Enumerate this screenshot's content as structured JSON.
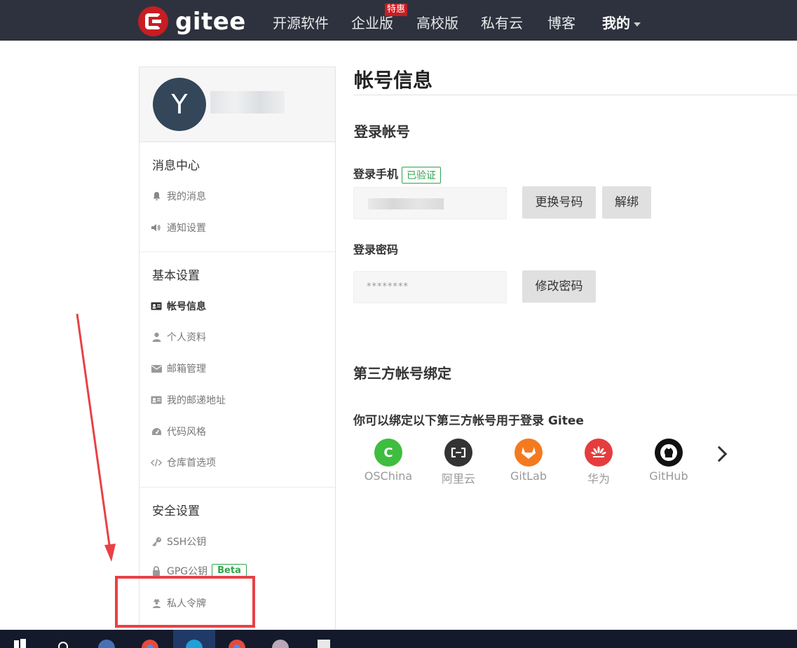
{
  "nav": {
    "brand": "gitee",
    "items": [
      "开源软件",
      "企业版",
      "高校版",
      "私有云",
      "博客"
    ],
    "promo_badge": "特惠",
    "mine": "我的"
  },
  "sidebar": {
    "avatar_letter": "Y",
    "sections": [
      {
        "title": "消息中心",
        "items": [
          {
            "label": "我的消息",
            "icon": "bell-icon"
          },
          {
            "label": "通知设置",
            "icon": "speaker-icon"
          }
        ]
      },
      {
        "title": "基本设置",
        "items": [
          {
            "label": "帐号信息",
            "icon": "id-card-icon",
            "active": true
          },
          {
            "label": "个人资料",
            "icon": "user-icon"
          },
          {
            "label": "邮箱管理",
            "icon": "envelope-icon"
          },
          {
            "label": "我的邮递地址",
            "icon": "address-card-icon"
          },
          {
            "label": "代码风格",
            "icon": "dashboard-icon"
          },
          {
            "label": "仓库首选项",
            "icon": "code-icon"
          }
        ]
      },
      {
        "title": "安全设置",
        "items": [
          {
            "label": "SSH公钥",
            "icon": "key-icon"
          },
          {
            "label": "GPG公钥",
            "icon": "lock-icon",
            "badge": "Beta"
          },
          {
            "label": "私人令牌",
            "icon": "user-secret-icon"
          }
        ]
      }
    ]
  },
  "main": {
    "title": "帐号信息",
    "login_section_title": "登录帐号",
    "phone_label": "登录手机",
    "phone_verified_badge": "已验证",
    "change_number_button": "更换号码",
    "unbind_button": "解绑",
    "password_label": "登录密码",
    "password_masked": "********",
    "change_password_button": "修改密码",
    "third_party_title": "第三方帐号绑定",
    "third_party_hint": "你可以绑定以下第三方帐号用于登录 Gitee",
    "providers": [
      {
        "name": "OSChina",
        "color": "#3fbd3f"
      },
      {
        "name": "阿里云",
        "color": "#333333"
      },
      {
        "name": "GitLab",
        "color": "#f47a20"
      },
      {
        "name": "华为",
        "color": "#e53d3d"
      },
      {
        "name": "GitHub",
        "color": "#111111"
      }
    ]
  },
  "colors": {
    "topbar_bg": "#2e323e",
    "brand_red": "#c71d23",
    "success_green": "#2fa54b",
    "annotation_red": "#e84146"
  }
}
